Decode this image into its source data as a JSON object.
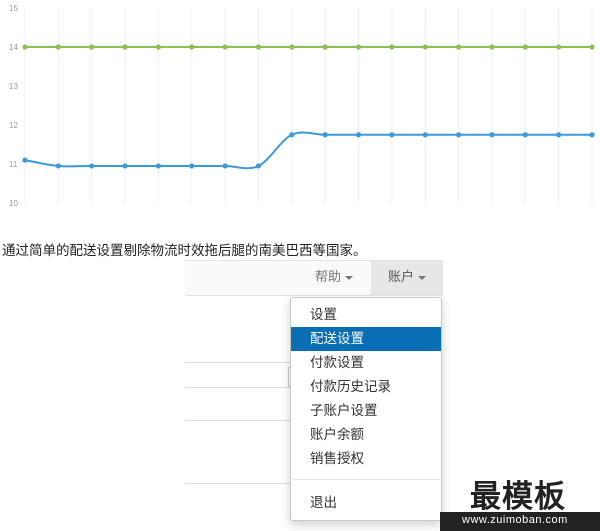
{
  "chart_data": {
    "type": "line",
    "x": [
      1,
      2,
      3,
      4,
      5,
      6,
      7,
      8,
      9,
      10,
      11,
      12,
      13,
      14,
      15,
      16,
      17,
      18
    ],
    "series": [
      {
        "values": [
          14,
          14,
          14,
          14,
          14,
          14,
          14,
          14,
          14,
          14,
          14,
          14,
          14,
          14,
          14,
          14,
          14,
          14
        ],
        "color": "#8cc152"
      },
      {
        "values": [
          11.1,
          10.95,
          10.95,
          10.95,
          10.95,
          10.95,
          10.95,
          10.95,
          11.75,
          11.75,
          11.75,
          11.75,
          11.75,
          11.75,
          11.75,
          11.75,
          11.75,
          11.75
        ],
        "color": "#3d9ad8"
      }
    ],
    "yticks": [
      "10",
      "11",
      "12",
      "13",
      "14",
      "15"
    ],
    "ylim": [
      10,
      15
    ],
    "grid": "vertical"
  },
  "caption": "通过简单的配送设置剔除物流时效拖后腿的南美巴西等国家。",
  "navbar": {
    "help_label": "帮助",
    "account_label": "账户"
  },
  "account_menu": {
    "items": [
      {
        "label": "设置",
        "active": false
      },
      {
        "label": "配送设置",
        "active": true
      },
      {
        "label": "付款设置",
        "active": false
      },
      {
        "label": "付款历史记录",
        "active": false
      },
      {
        "label": "子账户设置",
        "active": false
      },
      {
        "label": "账户余额",
        "active": false
      },
      {
        "label": "销售授权",
        "active": false
      }
    ],
    "logout_label": "退出",
    "active_color": "#0a6eb4"
  },
  "watermark": {
    "title": "最模板",
    "url": "www.zuimoban.com"
  }
}
